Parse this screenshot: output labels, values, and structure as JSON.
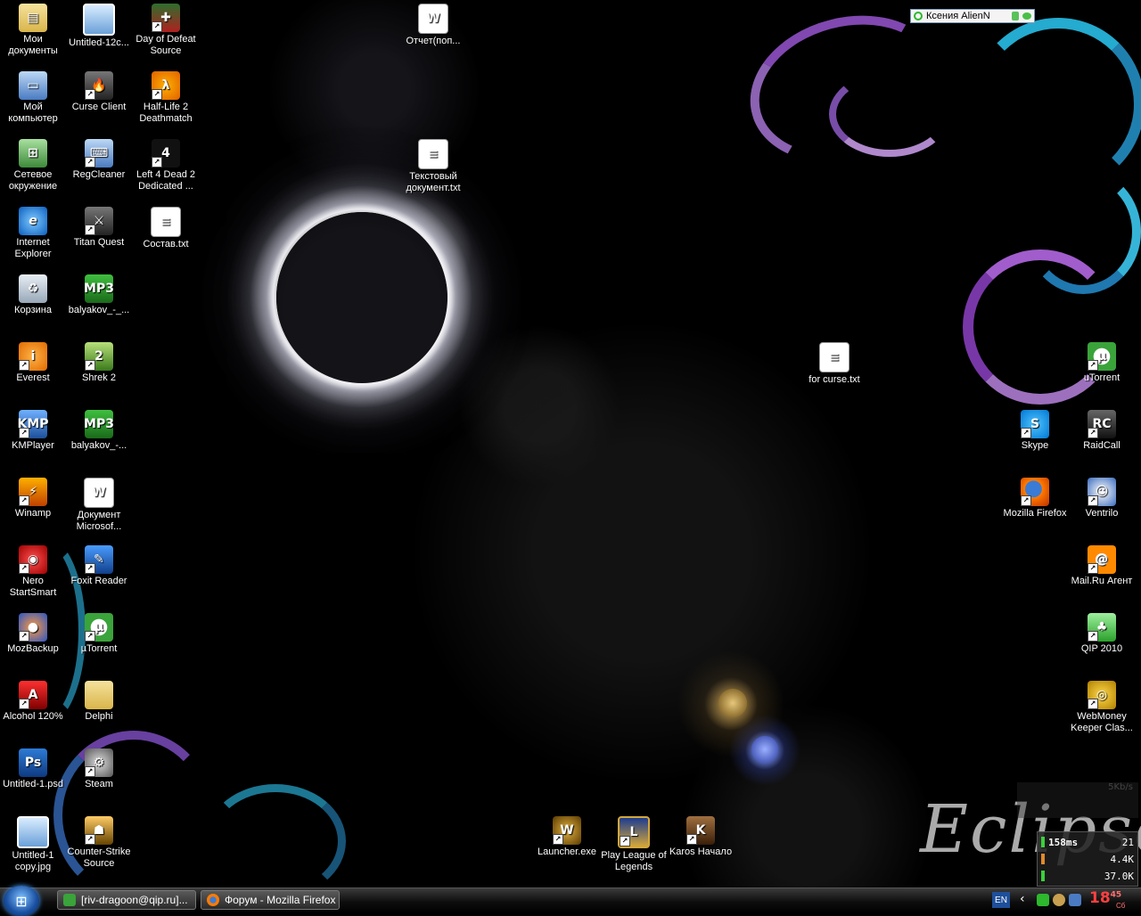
{
  "desktop": {
    "watermark": "Eclipse",
    "icons_left_col1": [
      {
        "label": "Мои документы",
        "icon": "folder-icon"
      },
      {
        "label": "Мой компьютер",
        "icon": "computer-icon"
      },
      {
        "label": "Сетевое окружение",
        "icon": "network-icon"
      },
      {
        "label": "Internet Explorer",
        "icon": "ie-icon"
      },
      {
        "label": "Корзина",
        "icon": "recycle-bin-icon"
      },
      {
        "label": "Everest",
        "icon": "everest-icon"
      },
      {
        "label": "KMPlayer",
        "icon": "kmplayer-icon"
      },
      {
        "label": "Winamp",
        "icon": "winamp-icon"
      },
      {
        "label": "Nero StartSmart",
        "icon": "nero-icon"
      },
      {
        "label": "MozBackup",
        "icon": "mozbackup-icon"
      },
      {
        "label": "Alcohol 120%",
        "icon": "alcohol-icon"
      },
      {
        "label": "Untitled-1.psd",
        "icon": "psd-file-icon"
      },
      {
        "label": "Untitled-1 copy.jpg",
        "icon": "jpg-file-icon"
      }
    ],
    "icons_left_col2": [
      {
        "label": "Untitled-12c...",
        "icon": "image-file-icon"
      },
      {
        "label": "Curse Client",
        "icon": "curse-icon"
      },
      {
        "label": "RegCleaner",
        "icon": "regcleaner-icon"
      },
      {
        "label": "Titan Quest",
        "icon": "titan-quest-icon"
      },
      {
        "label": "balyakov_-_...",
        "icon": "mp3-file-icon"
      },
      {
        "label": "Shrek 2",
        "icon": "shrek-icon"
      },
      {
        "label": "balyakov_-...",
        "icon": "mp3-file-icon"
      },
      {
        "label": "Документ Microsof...",
        "icon": "word-doc-icon"
      },
      {
        "label": "Foxit Reader",
        "icon": "foxit-icon"
      },
      {
        "label": "µTorrent",
        "icon": "utorrent-icon"
      },
      {
        "label": "Delphi",
        "icon": "folder-icon"
      },
      {
        "label": "Steam",
        "icon": "steam-icon"
      },
      {
        "label": "Counter-Strike Source",
        "icon": "counter-strike-icon"
      }
    ],
    "icons_left_col3": [
      {
        "label": "Day of Defeat Source",
        "icon": "dod-icon"
      },
      {
        "label": "Half-Life 2 Deathmatch",
        "icon": "half-life-icon"
      },
      {
        "label": "Left 4 Dead 2 Dedicated ...",
        "icon": "l4d-icon"
      },
      {
        "label": "Состав.txt",
        "icon": "text-file-icon"
      }
    ],
    "icons_mid": [
      {
        "label": "Отчет(поп...",
        "icon": "word-doc-icon"
      },
      {
        "label": "Текстовый документ.txt",
        "icon": "text-file-icon"
      },
      {
        "label": "for curse.txt",
        "icon": "text-file-icon"
      }
    ],
    "icons_bottom": [
      {
        "label": "Launcher.exe",
        "icon": "wow-launcher-icon"
      },
      {
        "label": "Play League of Legends",
        "icon": "lol-icon"
      },
      {
        "label": "Karos Начало",
        "icon": "karos-icon"
      }
    ],
    "icons_right_col1": [
      {
        "label": "Skype",
        "icon": "skype-icon"
      },
      {
        "label": "Mozilla Firefox",
        "icon": "firefox-icon"
      }
    ],
    "icons_right_col2": [
      {
        "label": "uTorrent",
        "icon": "utorrent-icon"
      },
      {
        "label": "RaidCall",
        "icon": "raidcall-icon"
      },
      {
        "label": "Ventrilo",
        "icon": "ventrilo-icon"
      },
      {
        "label": "Mail.Ru Агент",
        "icon": "mailru-icon"
      },
      {
        "label": "QIP 2010",
        "icon": "qip-icon"
      },
      {
        "label": "WebMoney Keeper Clas...",
        "icon": "webmoney-icon"
      }
    ]
  },
  "contact_widget": {
    "name": "Ксения AlienN"
  },
  "net_monitor": {
    "ping": "158ms",
    "count": "21",
    "down": "4.4K",
    "up": "37.0K",
    "ghost": "5Kb/s"
  },
  "taskbar": {
    "tasks": [
      {
        "label": "[riv-dragoon@qip.ru]...",
        "icon": "qip-chat-icon"
      },
      {
        "label": "Форум - Mozilla Firefox",
        "icon": "firefox-icon"
      }
    ],
    "lang": "EN",
    "clock_hour": "18",
    "clock_min": "45",
    "clock_sub": "Сб"
  }
}
